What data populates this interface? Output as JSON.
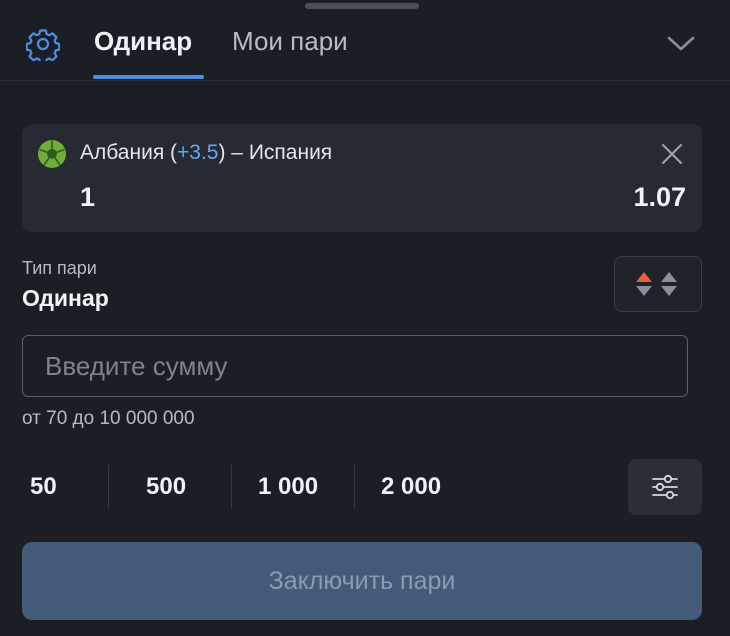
{
  "header": {
    "tabs": [
      {
        "label": "Одинар",
        "active": true
      },
      {
        "label": "Мои пари",
        "active": false
      }
    ],
    "icons": {
      "settings": "gear-icon",
      "collapse": "chevron-down-icon"
    }
  },
  "selection": {
    "sport_icon": "football-ball-icon",
    "team_home": "Албания (",
    "handicap": "+3.5",
    "team_away": ") – Испания",
    "outcome": "1",
    "odds": "1.07"
  },
  "bet_type": {
    "label": "Тип пари",
    "value": "Одинар"
  },
  "stake": {
    "placeholder": "Введите сумму",
    "value": "",
    "range_text": "от 70 до 10 000 000"
  },
  "presets": [
    "50",
    "500",
    "1 000",
    "2 000"
  ],
  "submit": {
    "label": "Заключить пари",
    "enabled": false
  },
  "colors": {
    "background": "#1b1e25",
    "card": "#262a32",
    "accent": "#4f8ee0",
    "handicap": "#6aa6f0",
    "submit_disabled": "#435a78",
    "arrow_up": "#e0653c"
  }
}
